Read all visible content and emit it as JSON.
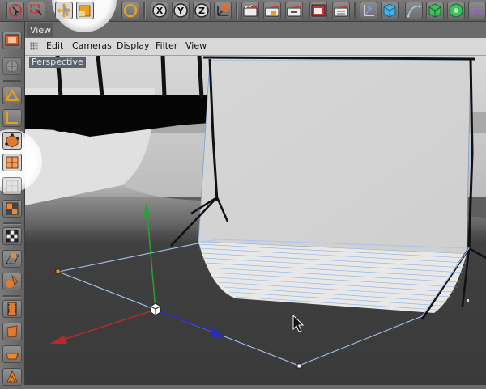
{
  "view_tab": "View",
  "menu": {
    "items": [
      "Edit",
      "Cameras",
      "Display",
      "Filter",
      "View"
    ]
  },
  "viewport": {
    "label": "Perspective"
  },
  "toolbar": {
    "axis_buttons": [
      "X",
      "Y",
      "Z"
    ],
    "icons": [
      "live-selection-icon",
      "rectangle-selection-icon",
      "move-icon",
      "scale-icon",
      "rotate-icon",
      "x-axis-lock-icon",
      "y-axis-lock-icon",
      "z-axis-lock-icon",
      "world-coordinates-icon",
      "render-view-icon",
      "render-picture-viewer-icon",
      "render-settings-icon",
      "edit-render-settings-icon",
      "render-queue-icon",
      "null-object-icon",
      "cube-icon",
      "pen-spline-icon",
      "subdivision-surface-icon",
      "array-icon"
    ]
  },
  "sidebar": {
    "icons": [
      "make-editable-icon",
      "model-mode-icon",
      "object-mode-icon",
      "axis-mode-icon",
      "points-mode-icon",
      "polygons-mode-icon",
      "edges-mode-icon",
      "uv-mode-icon",
      "texture-mode-icon",
      "workplane-icon",
      "snap-icon",
      "animation-mode-icon",
      "sculpt-icon",
      "paint-icon",
      "bucket-icon"
    ]
  },
  "colors": {
    "x_axis": "#b82a2a",
    "y_axis": "#22a52e",
    "z_axis": "#2a2ac0",
    "selection": "#a8c4f0",
    "highlight_circle": "#ffffff"
  }
}
